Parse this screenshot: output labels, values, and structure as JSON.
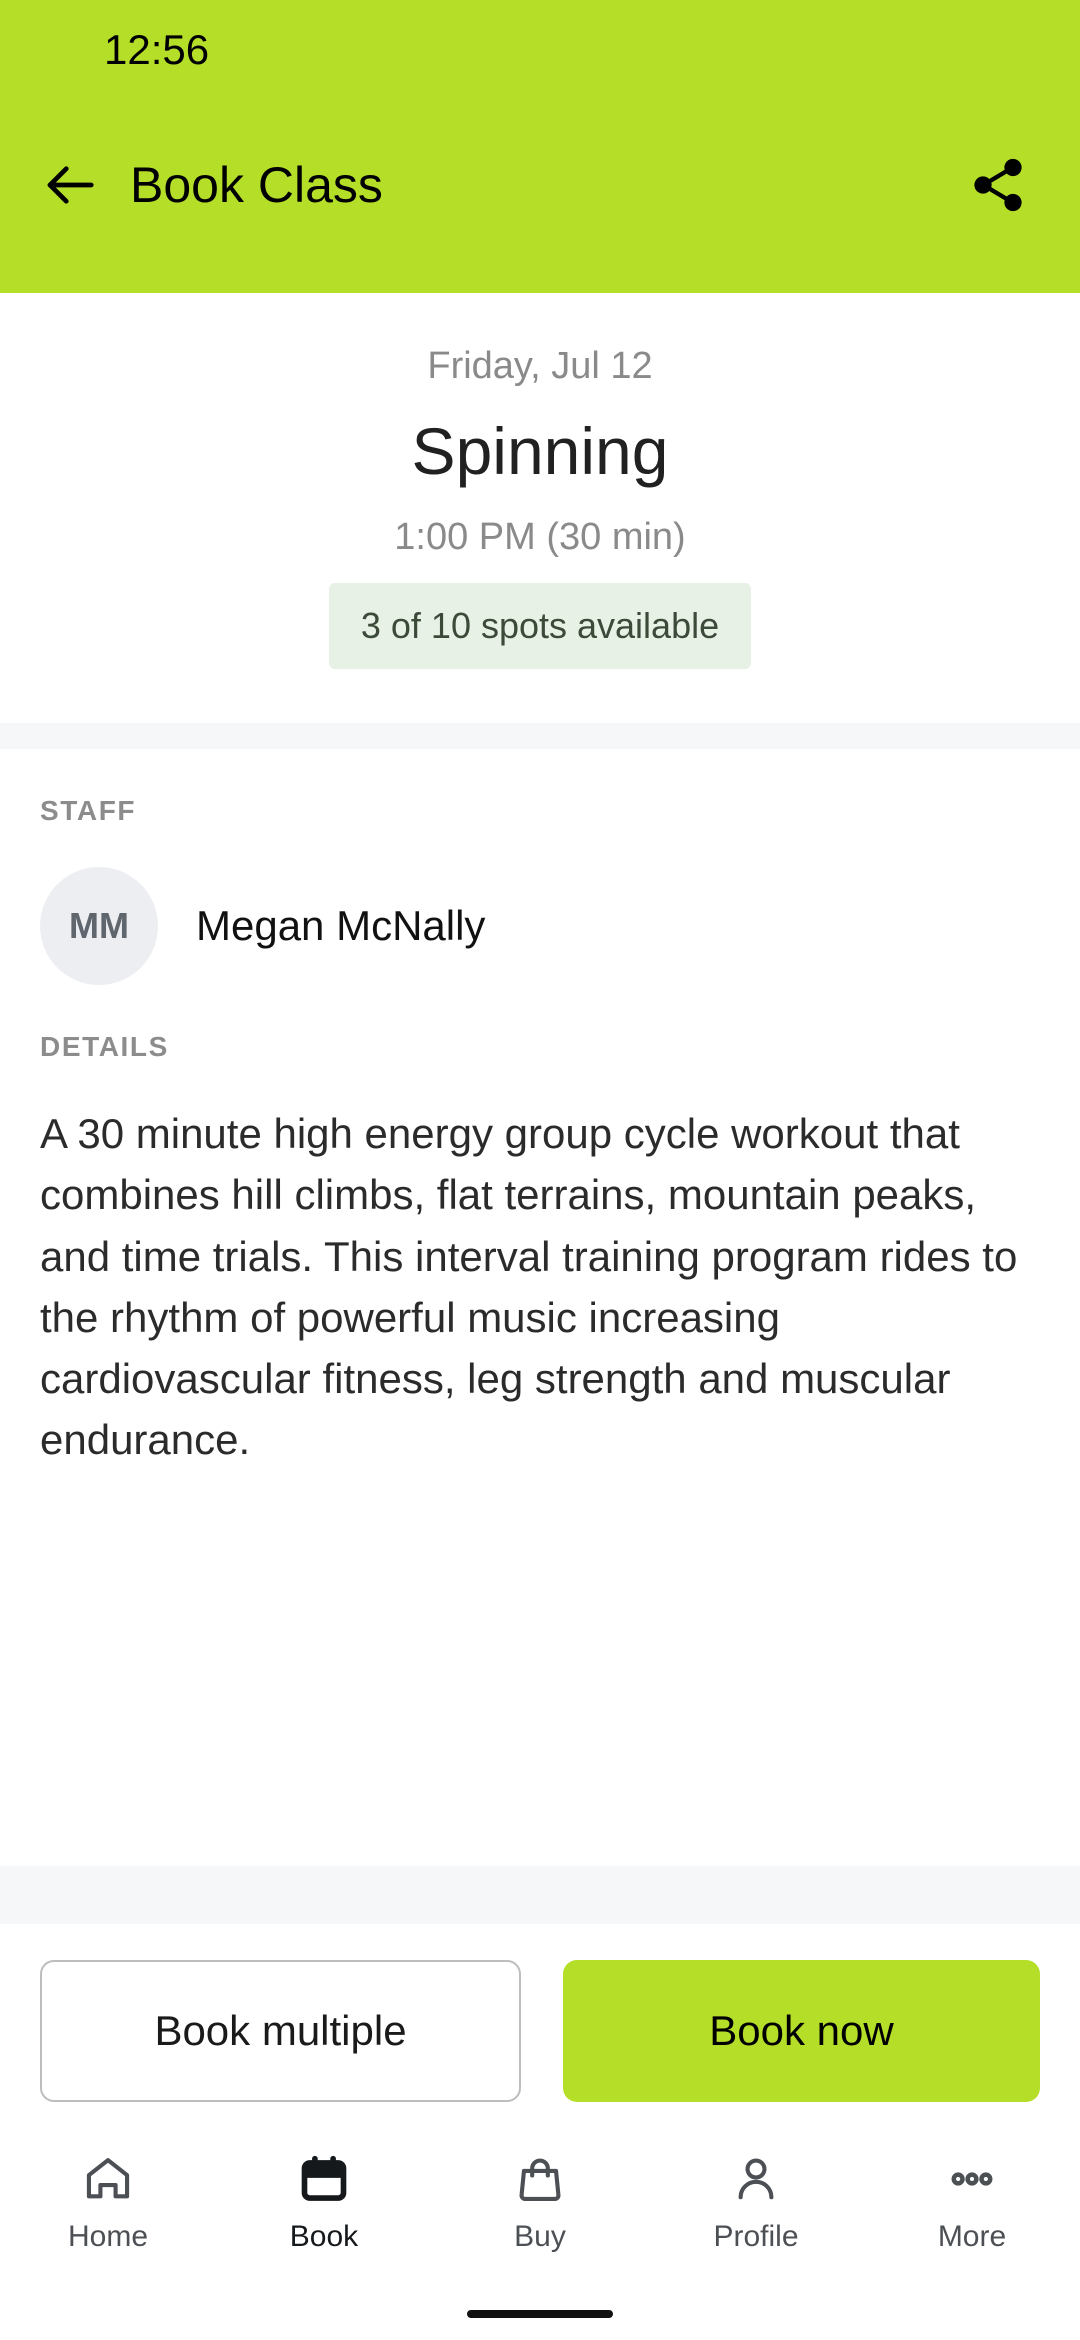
{
  "status_bar": {
    "time": "12:56"
  },
  "header": {
    "title": "Book Class",
    "back_icon": "arrow-left-icon",
    "share_icon": "share-icon",
    "background_color": "#b4de28"
  },
  "summary": {
    "date": "Friday, Jul 12",
    "class_name": "Spinning",
    "time": "1:00 PM (30 min)",
    "spots_badge": "3 of 10 spots available",
    "spots_badge_color": "#e8f1e5"
  },
  "staff": {
    "section_label": "STAFF",
    "members": [
      {
        "initials": "MM",
        "name": "Megan McNally"
      }
    ]
  },
  "details": {
    "section_label": "DETAILS",
    "body": "A 30 minute high energy group cycle workout that combines hill climbs, flat terrains, mountain peaks, and time trials. This interval training program rides to the rhythm of powerful music increasing cardiovascular fitness, leg strength and muscular endurance."
  },
  "actions": {
    "secondary_label": "Book multiple",
    "primary_label": "Book now",
    "primary_color": "#b4de28"
  },
  "bottom_nav": {
    "items": [
      {
        "label": "Home",
        "icon": "home-icon",
        "active": false
      },
      {
        "label": "Book",
        "icon": "calendar-icon",
        "active": true
      },
      {
        "label": "Buy",
        "icon": "shopping-bag-icon",
        "active": false
      },
      {
        "label": "Profile",
        "icon": "person-icon",
        "active": false
      },
      {
        "label": "More",
        "icon": "more-dots-icon",
        "active": false
      }
    ]
  }
}
